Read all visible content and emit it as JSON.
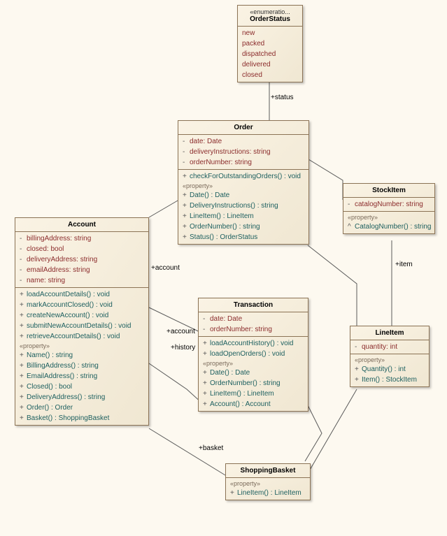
{
  "chart_data": {
    "type": "table",
    "title": "UML Class Diagram",
    "classes": [
      {
        "name": "OrderStatus",
        "stereotype": "«enumeratio...",
        "literals": [
          "new",
          "packed",
          "dispatched",
          "delivered",
          "closed"
        ]
      },
      {
        "name": "Order",
        "attributes": [
          "- date: Date",
          "- deliveryInstructions: string",
          "- orderNumber: string"
        ],
        "operations": [
          "+ checkForOutstandingOrders() : void"
        ],
        "properties": [
          "+ Date() : Date",
          "+ DeliveryInstructions() : string",
          "+ LineItem() : LineItem",
          "+ OrderNumber() : string",
          "+ Status() : OrderStatus"
        ]
      },
      {
        "name": "StockItem",
        "attributes": [
          "- catalogNumber: string"
        ],
        "properties": [
          "^ CatalogNumber() : string"
        ]
      },
      {
        "name": "Account",
        "attributes": [
          "- billingAddress: string",
          "- closed: bool",
          "- deliveryAddress: string",
          "- emailAddress: string",
          "- name: string"
        ],
        "operations": [
          "+ loadAccountDetails() : void",
          "+ markAccountClosed() : void",
          "+ createNewAccount() : void",
          "+ submitNewAccountDetails() : void",
          "+ retrieveAccountDetails() : void"
        ],
        "properties": [
          "+ Name() : string",
          "+ BillingAddress() : string",
          "+ EmailAddress() : string",
          "+ Closed() : bool",
          "+ DeliveryAddress() : string",
          "+ Order() : Order",
          "+ Basket() : ShoppingBasket"
        ]
      },
      {
        "name": "Transaction",
        "attributes": [
          "- date: Date",
          "- orderNumber: string"
        ],
        "operations": [
          "+ loadAccountHistory() : void",
          "+ loadOpenOrders() : void"
        ],
        "properties": [
          "+ Date() : Date",
          "+ OrderNumber() : string",
          "+ LineItem() : LineItem",
          "+ Account() : Account"
        ]
      },
      {
        "name": "LineItem",
        "attributes": [
          "- quantity: int"
        ],
        "properties": [
          "+ Quantity() : int",
          "+ Item() : StockItem"
        ]
      },
      {
        "name": "ShoppingBasket",
        "properties": [
          "+ LineItem() : LineItem"
        ]
      }
    ],
    "associations": [
      {
        "label": "+status",
        "from": "Order",
        "to": "OrderStatus"
      },
      {
        "label": "+account",
        "from": "Order",
        "to": "Account"
      },
      {
        "label": "+item",
        "from": "LineItem",
        "to": "StockItem"
      },
      {
        "label": "+account",
        "from": "Transaction",
        "to": "Account"
      },
      {
        "label": "+history",
        "from": "Account",
        "to": "Transaction"
      },
      {
        "label": "+basket",
        "from": "Account",
        "to": "ShoppingBasket"
      }
    ]
  },
  "orderStatus": {
    "stereo": "«enumeratio...",
    "name": "OrderStatus",
    "l0": "new",
    "l1": "packed",
    "l2": "dispatched",
    "l3": "delivered",
    "l4": "closed"
  },
  "order": {
    "name": "Order",
    "a0": "date: Date",
    "a1": "deliveryInstructions: string",
    "a2": "orderNumber: string",
    "o0": "checkForOutstandingOrders() : void",
    "pLbl": "«property»",
    "p0": "Date() : Date",
    "p1": "DeliveryInstructions() : string",
    "p2": "LineItem() : LineItem",
    "p3": "OrderNumber() : string",
    "p4": "Status() : OrderStatus"
  },
  "stock": {
    "name": "StockItem",
    "a0": "catalogNumber: string",
    "pLbl": "«property»",
    "p0": "CatalogNumber() : string"
  },
  "account": {
    "name": "Account",
    "a0": "billingAddress: string",
    "a1": "closed: bool",
    "a2": "deliveryAddress: string",
    "a3": "emailAddress: string",
    "a4": "name: string",
    "o0": "loadAccountDetails() : void",
    "o1": "markAccountClosed() : void",
    "o2": "createNewAccount() : void",
    "o3": "submitNewAccountDetails() : void",
    "o4": "retrieveAccountDetails() : void",
    "pLbl": "«property»",
    "p0": "Name() : string",
    "p1": "BillingAddress() : string",
    "p2": "EmailAddress() : string",
    "p3": "Closed() : bool",
    "p4": "DeliveryAddress() : string",
    "p5": "Order() : Order",
    "p6": "Basket() : ShoppingBasket"
  },
  "trans": {
    "name": "Transaction",
    "a0": "date: Date",
    "a1": "orderNumber: string",
    "o0": "loadAccountHistory() : void",
    "o1": "loadOpenOrders() : void",
    "pLbl": "«property»",
    "p0": "Date() : Date",
    "p1": "OrderNumber() : string",
    "p2": "LineItem() : LineItem",
    "p3": "Account() : Account"
  },
  "line": {
    "name": "LineItem",
    "a0": "quantity: int",
    "pLbl": "«property»",
    "p0": "Quantity() : int",
    "p1": "Item() : StockItem"
  },
  "basket": {
    "name": "ShoppingBasket",
    "pLbl": "«property»",
    "p0": "LineItem() : LineItem"
  },
  "labels": {
    "status": "+status",
    "account": "+account",
    "item": "+item",
    "history": "+history",
    "basket": "+basket"
  }
}
